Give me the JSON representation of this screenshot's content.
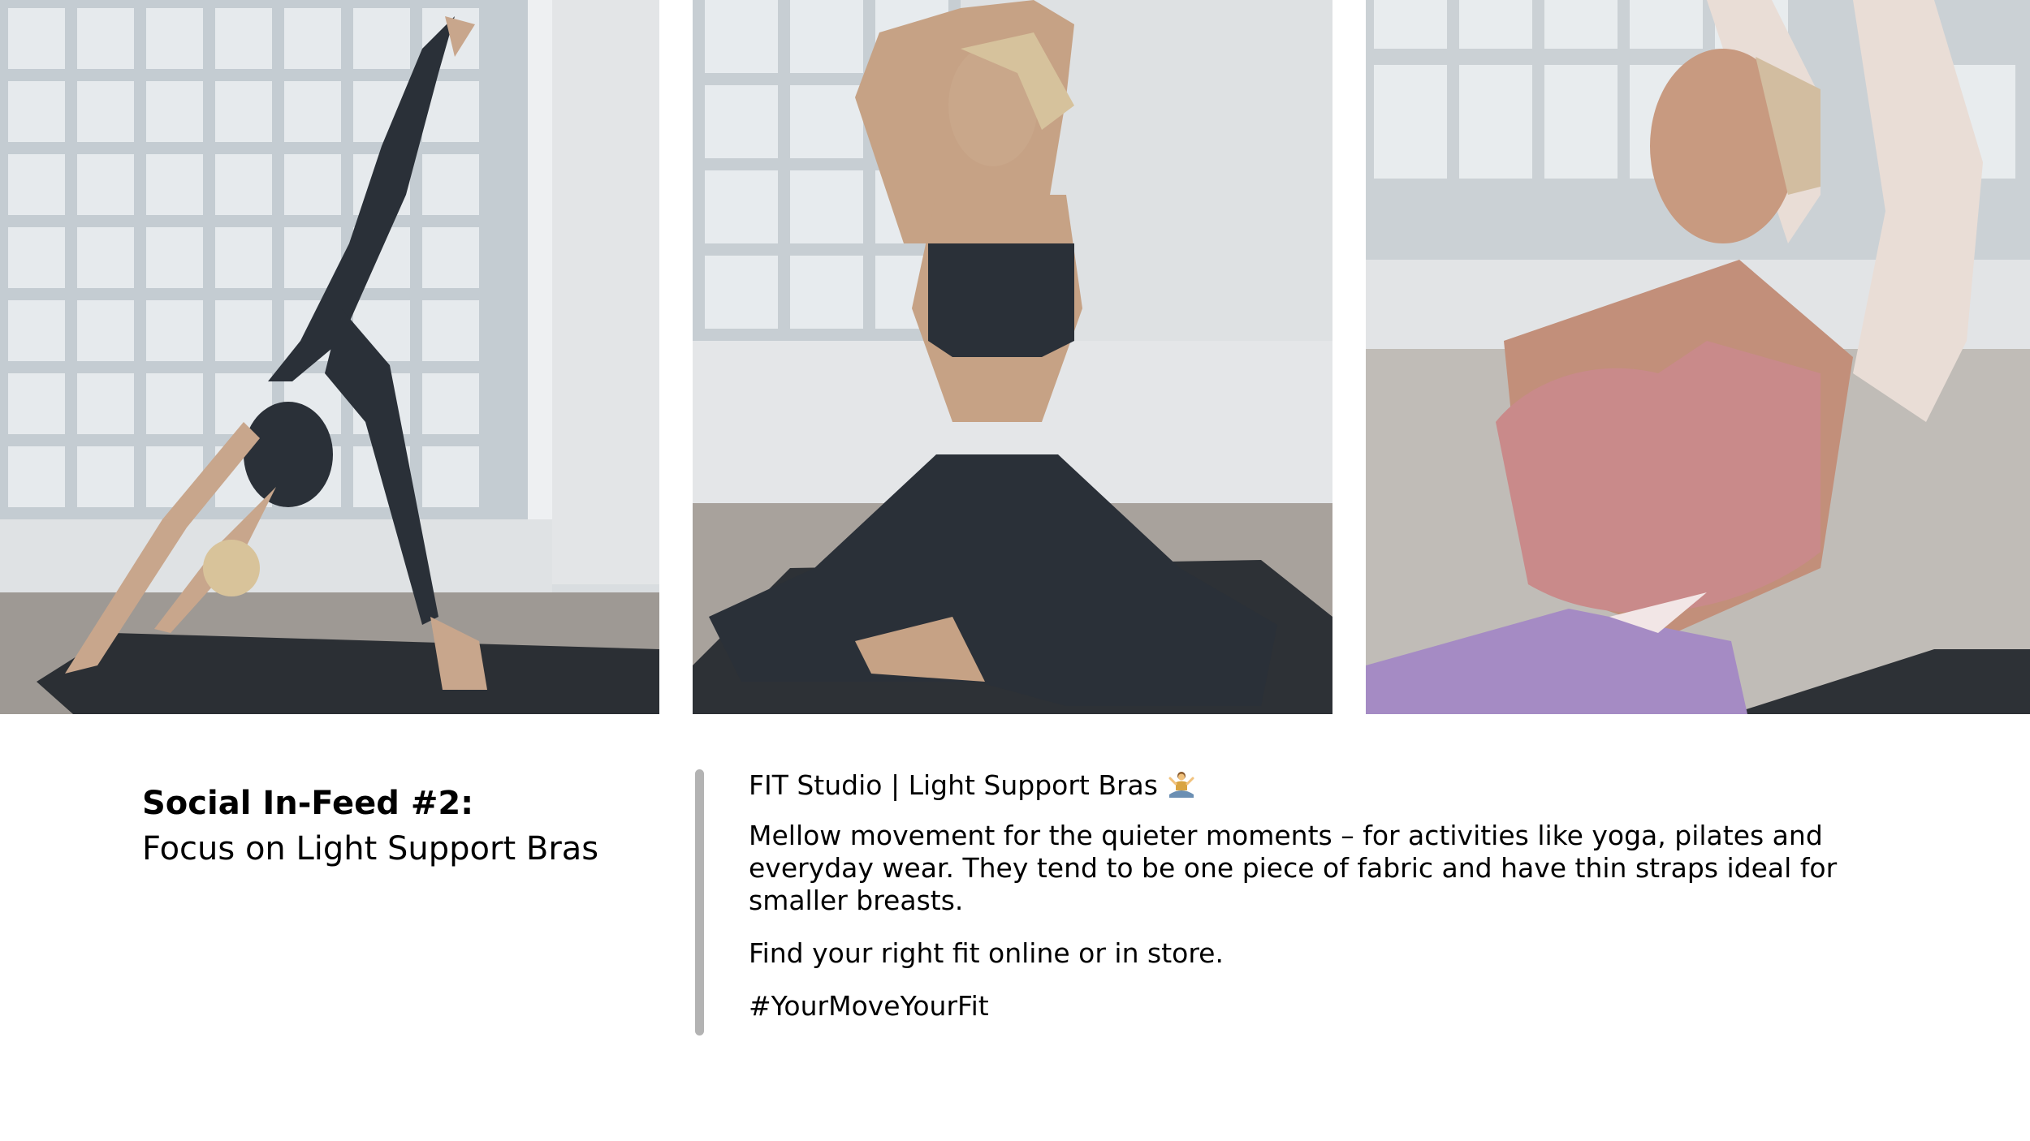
{
  "photos": [
    {
      "alt": "downward-dog-split"
    },
    {
      "alt": "seated-arm-stretch"
    },
    {
      "alt": "kneeling-backbend"
    }
  ],
  "title": {
    "line1": "Social In-Feed #2:",
    "line2": "Focus on Light Support Bras"
  },
  "post": {
    "headline": "FIT Studio | Light Support Bras",
    "headline_icon": "yoga-person-icon",
    "body": "Mellow movement for the quieter moments – for activities like yoga, pilates and everyday wear. They tend to be one piece of fabric and have thin straps ideal for smaller breasts.",
    "cta": "Find your right fit online or in store.",
    "hashtag": "#YourMoveYourFit"
  },
  "colors": {
    "divider": "#b3b3b3",
    "text": "#000000",
    "background": "#ffffff",
    "bra_dark": "#2a3038",
    "bra_pink": "#c98a8a",
    "leggings_purple": "#a58bc4"
  }
}
